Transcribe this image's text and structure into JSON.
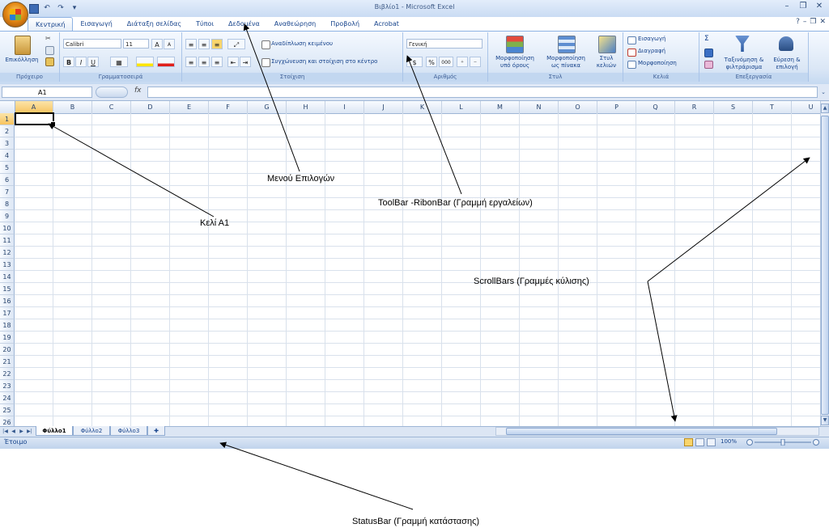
{
  "window": {
    "title": "Βιβλίο1 - Microsoft Excel",
    "qat": {
      "undo": "↶",
      "redo": "↷",
      "customize": "▾"
    },
    "controls": {
      "minimize": "–",
      "restore": "❐",
      "close": "✕"
    },
    "doc_controls": {
      "help": "?",
      "minimize": "–",
      "restore": "❐",
      "close": "✕"
    }
  },
  "tabs": [
    {
      "label": "Κεντρική",
      "active": true
    },
    {
      "label": "Εισαγωγή"
    },
    {
      "label": "Διάταξη σελίδας"
    },
    {
      "label": "Τύποι"
    },
    {
      "label": "Δεδομένα"
    },
    {
      "label": "Αναθεώρηση"
    },
    {
      "label": "Προβολή"
    },
    {
      "label": "Acrobat"
    }
  ],
  "ribbon": {
    "clipboard": {
      "label": "Πρόχειρο",
      "paste": "Επικόλληση"
    },
    "font": {
      "label": "Γραμματοσειρά",
      "name": "Calibri",
      "size": "11",
      "bold": "B",
      "italic": "I",
      "underline": "U",
      "grow": "A",
      "shrink": "A"
    },
    "alignment": {
      "label": "Στοίχιση",
      "wrap": "Αναδίπλωση κειμένου",
      "merge": "Συγχώνευση και στοίχιση στο κέντρο"
    },
    "number": {
      "label": "Αριθμός",
      "format": "Γενική",
      "percent": "%",
      "thousands": "000"
    },
    "styles": {
      "label": "Στυλ",
      "conditional": "Μορφοποίηση υπό όρους",
      "table": "Μορφοποίηση ως πίνακα",
      "cell": "Στυλ κελιών"
    },
    "cells": {
      "label": "Κελιά",
      "insert": "Εισαγωγή",
      "delete": "Διαγραφή",
      "format": "Μορφοποίηση"
    },
    "editing": {
      "label": "Επεξεργασία",
      "sort": "Ταξινόμηση & φιλτράρισμα",
      "find": "Εύρεση & επιλογή",
      "sigma": "Σ"
    }
  },
  "formula_bar": {
    "name_box": "A1",
    "fx": "fx",
    "value": ""
  },
  "grid": {
    "columns": [
      "A",
      "B",
      "C",
      "D",
      "E",
      "F",
      "G",
      "H",
      "I",
      "J",
      "K",
      "L",
      "M",
      "N",
      "O",
      "P",
      "Q",
      "R",
      "S",
      "T",
      "U"
    ],
    "rows": [
      "1",
      "2",
      "3",
      "4",
      "5",
      "6",
      "7",
      "8",
      "9",
      "10",
      "11",
      "12",
      "13",
      "14",
      "15",
      "16",
      "17",
      "18",
      "19",
      "20",
      "21",
      "22",
      "23",
      "24",
      "25",
      "26"
    ],
    "selected_cell": "A1"
  },
  "sheets": [
    {
      "label": "Φύλλο1",
      "active": true
    },
    {
      "label": "Φύλλο2"
    },
    {
      "label": "Φύλλο3"
    }
  ],
  "status": {
    "text": "Έτοιμο",
    "zoom": "100%"
  },
  "annotations": {
    "cell": "Κελί Α1",
    "menu": "Μενού Επιλογών",
    "toolbar": "ToolBar -RibonBar (Γραμμή εργαλείων)",
    "scrollbars": "ScrollBars (Γραμμές κύλισης)",
    "statusbar": "StatusBar (Γραμμή κατάστασης)"
  },
  "colors": {
    "accent": "#15428b",
    "ribbon": "#dbe7f6",
    "selection": "#f7c35f"
  }
}
